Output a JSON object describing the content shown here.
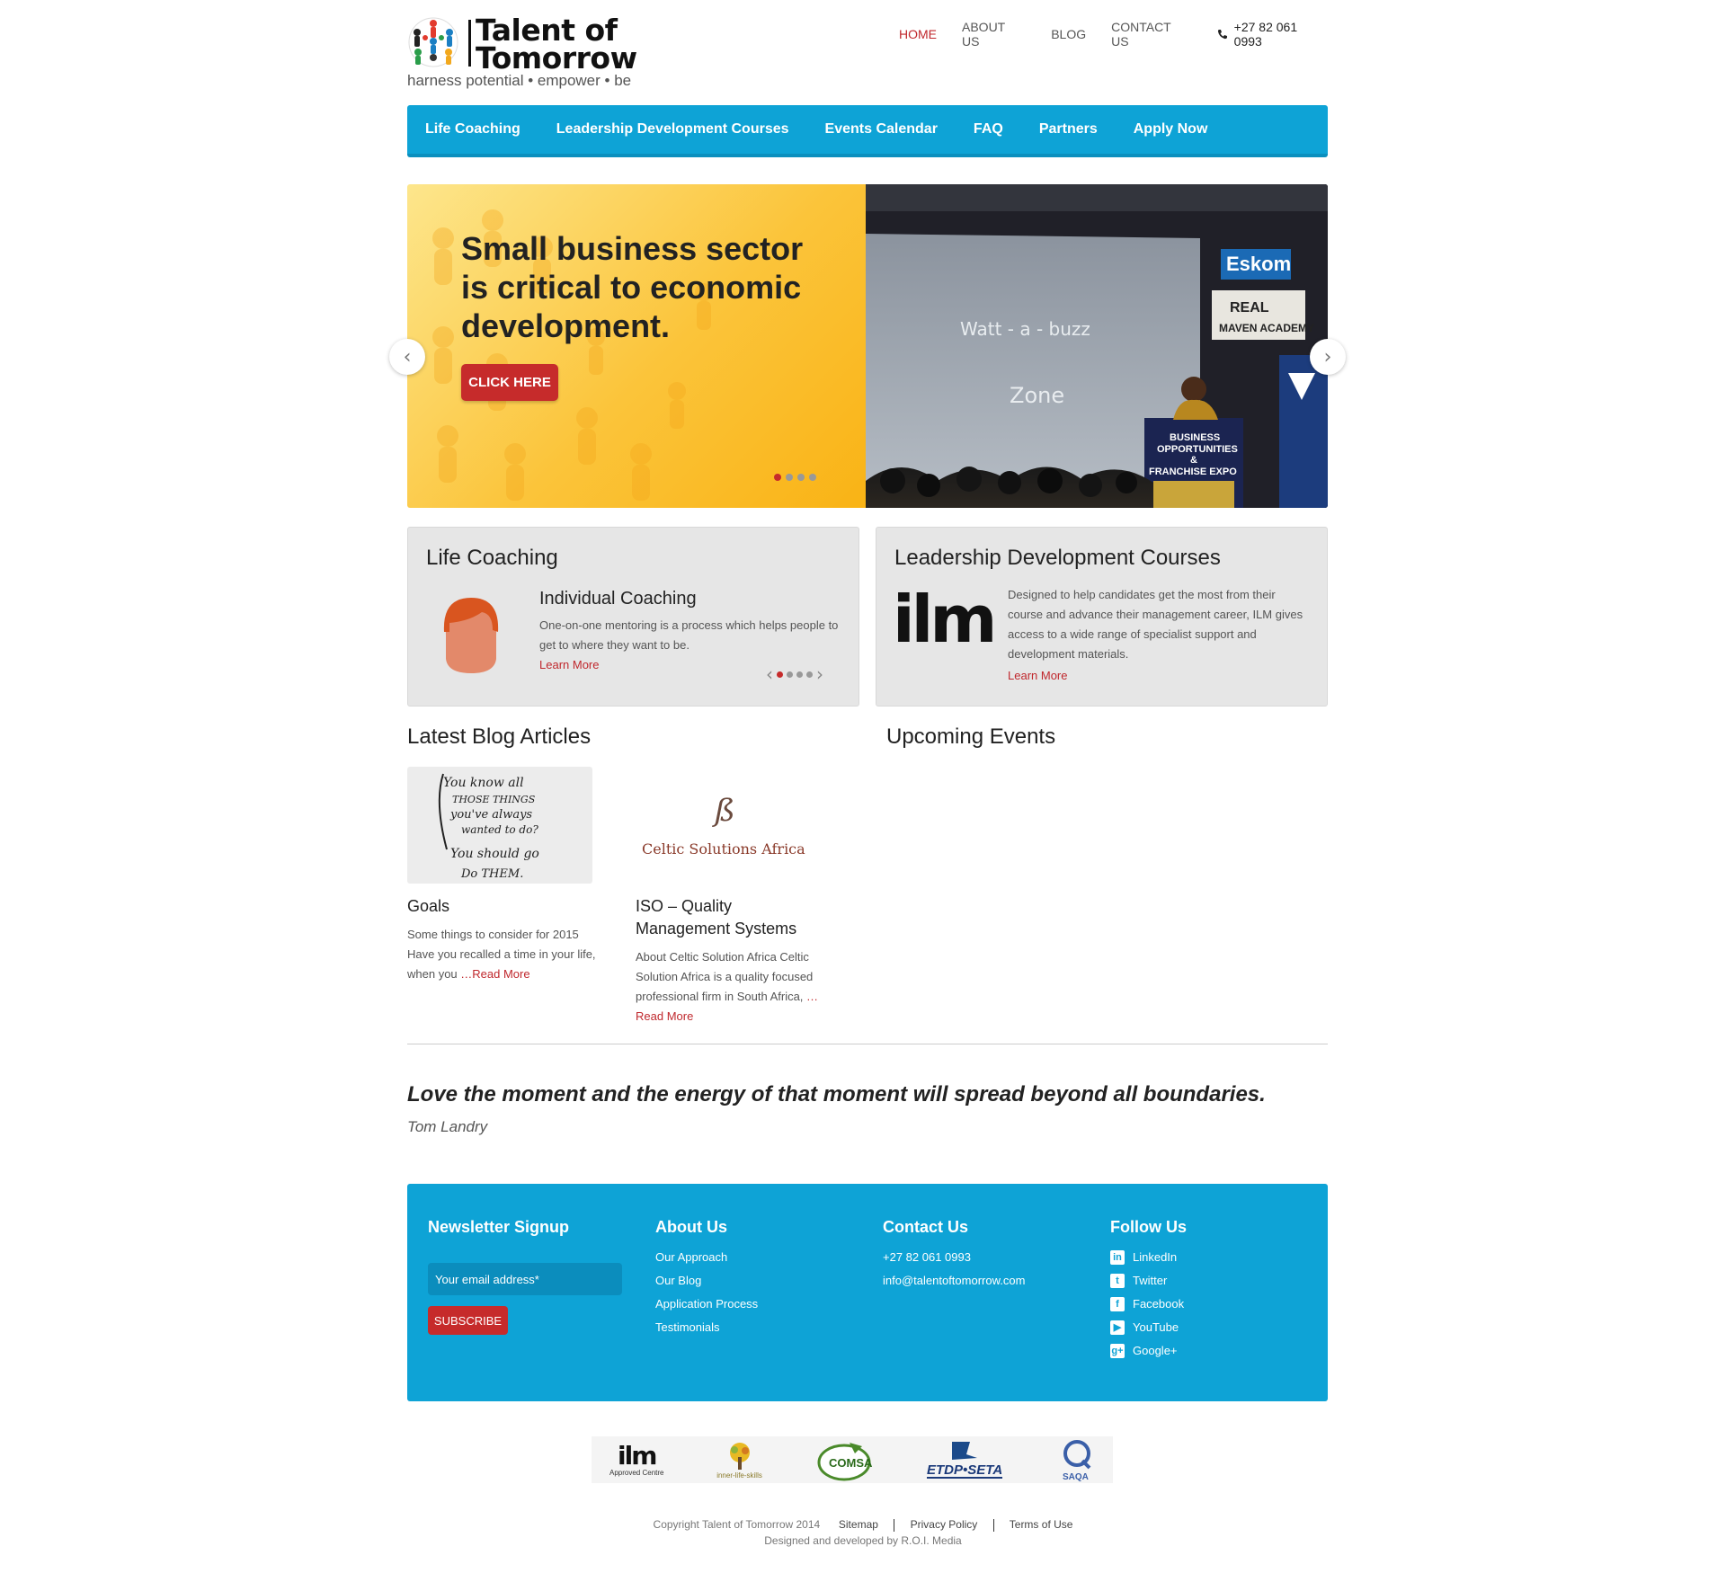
{
  "brand": {
    "title_line1": "Talent of",
    "title_line2": "Tomorrow",
    "tagline": "harness potential • empower • be"
  },
  "topnav": {
    "items": [
      {
        "label": "HOME",
        "active": true
      },
      {
        "label": "ABOUT US"
      },
      {
        "label": "BLOG"
      },
      {
        "label": "CONTACT US"
      }
    ],
    "phone": "+27 82 061 0993"
  },
  "mainnav": {
    "items": [
      "Life Coaching",
      "Leadership Development Courses",
      "Events Calendar",
      "FAQ",
      "Partners",
      "Apply Now"
    ]
  },
  "slider": {
    "headline": "Small business sector is critical to economic development.",
    "cta": "CLICK HERE",
    "dots": 4,
    "active_dot": 1,
    "photo_text": {
      "screen_line1": "Watt - a - buzz",
      "screen_line2": "Zone",
      "sign_eskom": "Eskom",
      "sign_real": "REAL",
      "sign_maven": "MAVEN ACADEMY",
      "podium_line1": "BUSINESS",
      "podium_line2": "OPPORTUNITIES",
      "podium_line3": "&",
      "podium_line4": "FRANCHISE EXPO"
    }
  },
  "life_coaching": {
    "title": "Life Coaching",
    "item_title": "Individual Coaching",
    "item_desc": "One-on-one mentoring is a process which helps people to get to where they want to be.",
    "learn_more": "Learn More",
    "dots": 4,
    "active_dot": 1
  },
  "leadership": {
    "title": "Leadership Development Courses",
    "logo_text": "ilm",
    "desc": "Designed to help candidates get the most from their course and advance their management career, ILM gives access to a wide range of specialist support and development materials.",
    "learn_more": "Learn More"
  },
  "blog": {
    "title": "Latest Blog Articles",
    "articles": [
      {
        "title": "Goals",
        "excerpt": "Some things to consider for 2015 Have you recalled a time in your life, when you ",
        "more": "…Read More",
        "thumb_text": [
          "You know all",
          "THOSE THINGS",
          "you've always",
          "wanted to do?",
          "You should go",
          "Do THEM."
        ]
      },
      {
        "title": "ISO – Quality Management Systems",
        "excerpt": "About Celtic Solution Africa Celtic Solution Africa is a quality focused professional firm in South Africa, ",
        "more": "…Read More",
        "thumb_text": "Celtic Solutions Africa"
      }
    ]
  },
  "events": {
    "title": "Upcoming Events"
  },
  "quote": {
    "text": "Love the moment and the energy of that moment will spread beyond all boundaries.",
    "author": "Tom Landry"
  },
  "footer": {
    "newsletter": {
      "title": "Newsletter Signup",
      "placeholder": "Your email address*",
      "button": "SUBSCRIBE"
    },
    "about": {
      "title": "About Us",
      "links": [
        "Our Approach",
        "Our Blog",
        "Application Process",
        "Testimonials"
      ]
    },
    "contact": {
      "title": "Contact Us",
      "phone": "+27 82 061 0993",
      "email": "info@talentoftomorrow.com"
    },
    "follow": {
      "title": "Follow Us",
      "links": [
        {
          "label": "LinkedIn",
          "icon": "linkedin-icon",
          "glyph": "in"
        },
        {
          "label": "Twitter",
          "icon": "twitter-icon",
          "glyph": "t"
        },
        {
          "label": "Facebook",
          "icon": "facebook-icon",
          "glyph": "f"
        },
        {
          "label": "YouTube",
          "icon": "youtube-icon",
          "glyph": "▶"
        },
        {
          "label": "Google+",
          "icon": "google-plus-icon",
          "glyph": "g+"
        }
      ]
    }
  },
  "partners": [
    {
      "name": "ilm",
      "caption": "Approved Centre"
    },
    {
      "name": "inner-life-skills",
      "caption": "inner-life-skills"
    },
    {
      "name": "COMSA",
      "caption": "COMSA"
    },
    {
      "name": "ETDP SETA",
      "caption": "ETDP•SETA"
    },
    {
      "name": "SAQA",
      "caption": "SAQA"
    }
  ],
  "legal": {
    "copyright": "Copyright Talent of Tomorrow 2014",
    "links": [
      "Sitemap",
      "Privacy Policy",
      "Terms of Use"
    ],
    "credits": "Designed and developed by R.O.I. Media"
  },
  "colors": {
    "primary_blue": "#0ea3d6",
    "accent_red": "#c0282d",
    "slide_yellow": "#fbc43a"
  }
}
